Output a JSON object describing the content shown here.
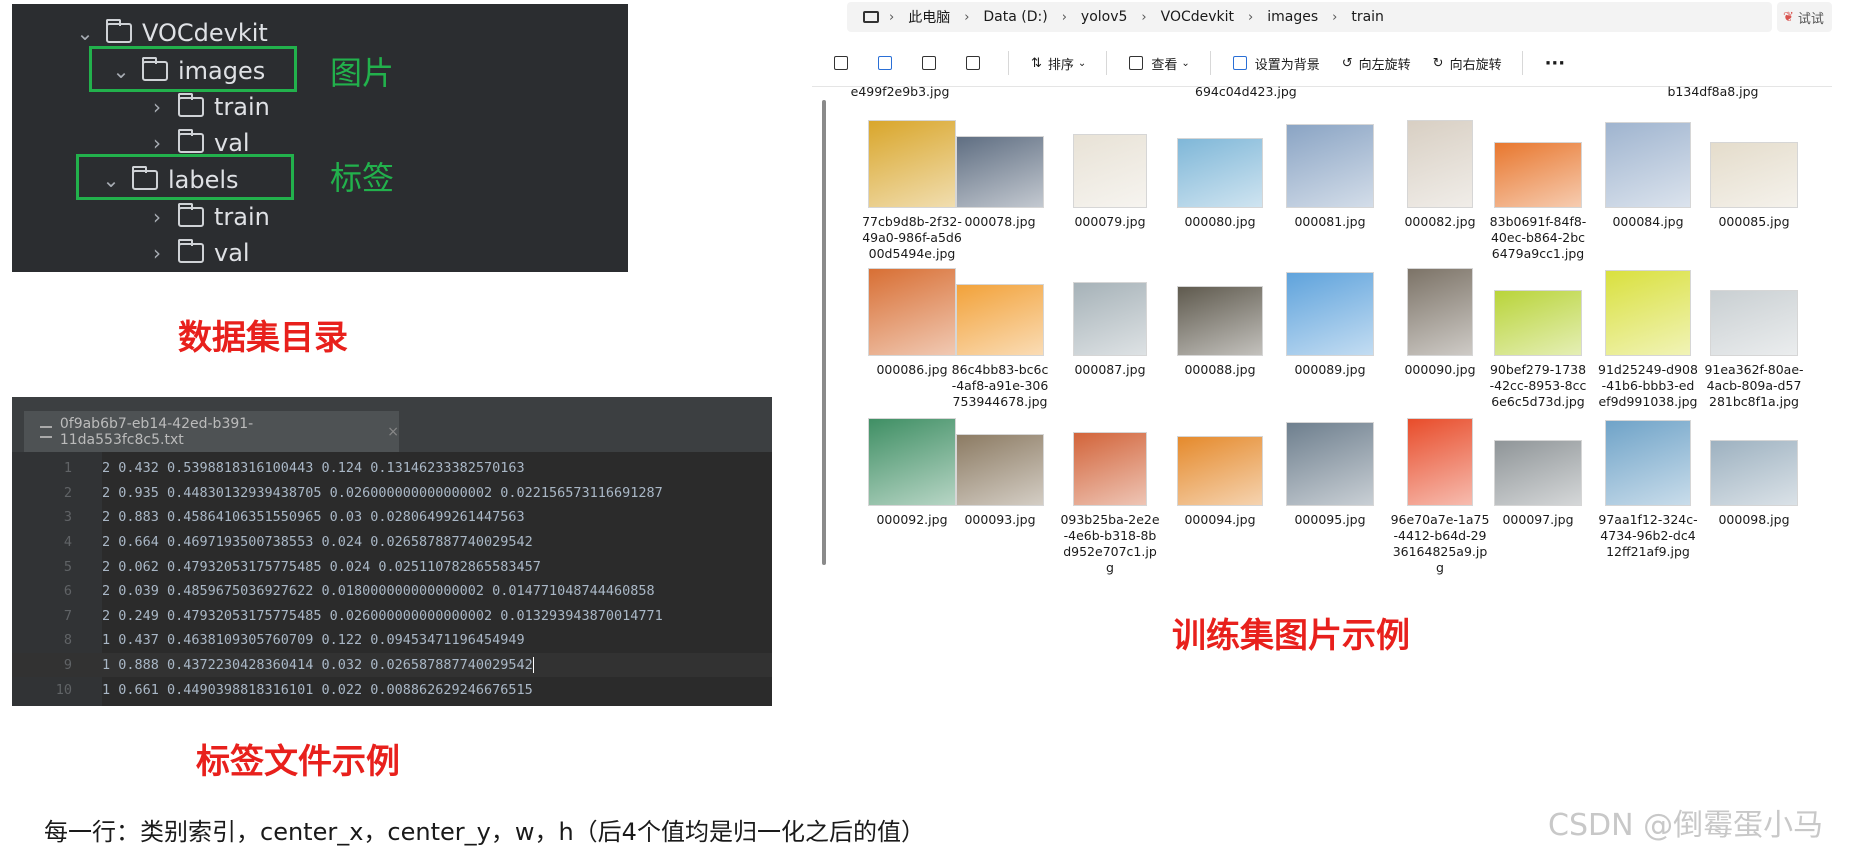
{
  "tree": {
    "root": "VOCdevkit",
    "images": "images",
    "images_train": "train",
    "images_val": "val",
    "labels": "labels",
    "labels_train": "train",
    "labels_val": "val",
    "note_images": "图片",
    "note_labels": "标签",
    "caption": "数据集目录"
  },
  "editor": {
    "tab_title": "0f9ab6b7-eb14-42ed-b391-11da553fc8c5.txt",
    "tab_close": "×",
    "lines": [
      {
        "n": "1",
        "text": "2 0.432 0.5398818316100443 0.124 0.13146233382570163"
      },
      {
        "n": "2",
        "text": "2 0.935 0.44830132939438705 0.026000000000000002 0.022156573116691287"
      },
      {
        "n": "3",
        "text": "2 0.883 0.45864106351550965 0.03 0.02806499261447563"
      },
      {
        "n": "4",
        "text": "2 0.664 0.4697193500738553 0.024 0.026587887740029542"
      },
      {
        "n": "5",
        "text": "2 0.062 0.47932053175775485 0.024 0.025110782865583457"
      },
      {
        "n": "6",
        "text": "2 0.039 0.4859675036927622 0.018000000000000002 0.014771048744460858"
      },
      {
        "n": "7",
        "text": "2 0.249 0.47932053175775485 0.026000000000000002 0.013293943870014771"
      },
      {
        "n": "8",
        "text": "1 0.437 0.4638109305760709 0.122 0.09453471196454949"
      },
      {
        "n": "9",
        "text": "1 0.888 0.4372230428360414 0.032 0.026587887740029542"
      },
      {
        "n": "10",
        "text": "1 0.661 0.4490398818316101 0.022 0.008862629246676515"
      }
    ],
    "caption": "标签文件示例"
  },
  "explorer": {
    "breadcrumbs": [
      "此电脑",
      "Data (D:)",
      "yolov5",
      "VOCdevkit",
      "images",
      "train"
    ],
    "try_label": "试试",
    "toolbar": {
      "sort": "排序",
      "view": "查看",
      "set_bg": "设置为背景",
      "rotate_left": "向左旋转",
      "rotate_right": "向右旋转",
      "more": "···"
    },
    "partial_top": [
      "e499f2e9b3.jpg",
      "694c04d423.jpg",
      "b134df8a8.jpg"
    ],
    "files": [
      {
        "name": "77cb9d8b-2f32-49a0-986f-a5d600d5494e.jpg",
        "color": "#d9a62b"
      },
      {
        "name": "000078.jpg",
        "color": "#5f6e82"
      },
      {
        "name": "000079.jpg",
        "color": "#e8e2d6"
      },
      {
        "name": "000080.jpg",
        "color": "#7fb7d8"
      },
      {
        "name": "000081.jpg",
        "color": "#8aa4c4"
      },
      {
        "name": "000082.jpg",
        "color": "#d8cfc3"
      },
      {
        "name": "83b0691f-84f8-40ec-b864-2bc6479a9cc1.jpg",
        "color": "#e8772e"
      },
      {
        "name": "000084.jpg",
        "color": "#9fb4cf"
      },
      {
        "name": "000085.jpg",
        "color": "#e4dccb"
      },
      {
        "name": "000086.jpg",
        "color": "#d86f34"
      },
      {
        "name": "86c4bb83-bc6c-4af8-a91e-306753944678.jpg",
        "color": "#f2a23a"
      },
      {
        "name": "000087.jpg",
        "color": "#a6b2b8"
      },
      {
        "name": "000088.jpg",
        "color": "#5f5a4e"
      },
      {
        "name": "000089.jpg",
        "color": "#5fa3dc"
      },
      {
        "name": "000090.jpg",
        "color": "#7c7367"
      },
      {
        "name": "90bef279-1738-42cc-8953-8cc6e6c5d73d.jpg",
        "color": "#b9d43a"
      },
      {
        "name": "91d25249-d908-41b6-bbb3-edef9d991038.jpg",
        "color": "#d9e03e"
      },
      {
        "name": "91ea362f-80ae-4acb-809a-d57281bc8f1a.jpg",
        "color": "#c9cfd2"
      },
      {
        "name": "000092.jpg",
        "color": "#3f8f64"
      },
      {
        "name": "000093.jpg",
        "color": "#8c7b63"
      },
      {
        "name": "093b25ba-2e2e-4e6b-b318-8bd952e707c1.jpg",
        "color": "#d2643a"
      },
      {
        "name": "000094.jpg",
        "color": "#e58a2c"
      },
      {
        "name": "000095.jpg",
        "color": "#6e7f8e"
      },
      {
        "name": "96e70a7e-1a75-4412-b64d-2936164825a9.jpg",
        "color": "#e84c2a"
      },
      {
        "name": "000097.jpg",
        "color": "#8f9598"
      },
      {
        "name": "97aa1f12-324c-4734-96b2-dc412ff21af9.jpg",
        "color": "#6fa3c8"
      },
      {
        "name": "000098.jpg",
        "color": "#9db1c0"
      }
    ],
    "caption": "训练集图片示例"
  },
  "footer": {
    "note": "每一行：类别索引，center_x，center_y，w，h（后4个值均是归一化之后的值）",
    "watermark": "CSDN @倒霉蛋小马"
  },
  "colors": {
    "green": "#22b14c",
    "red": "#e8201c",
    "tree_bg": "#2b2d30",
    "editor_bg": "#2b2b2b"
  }
}
